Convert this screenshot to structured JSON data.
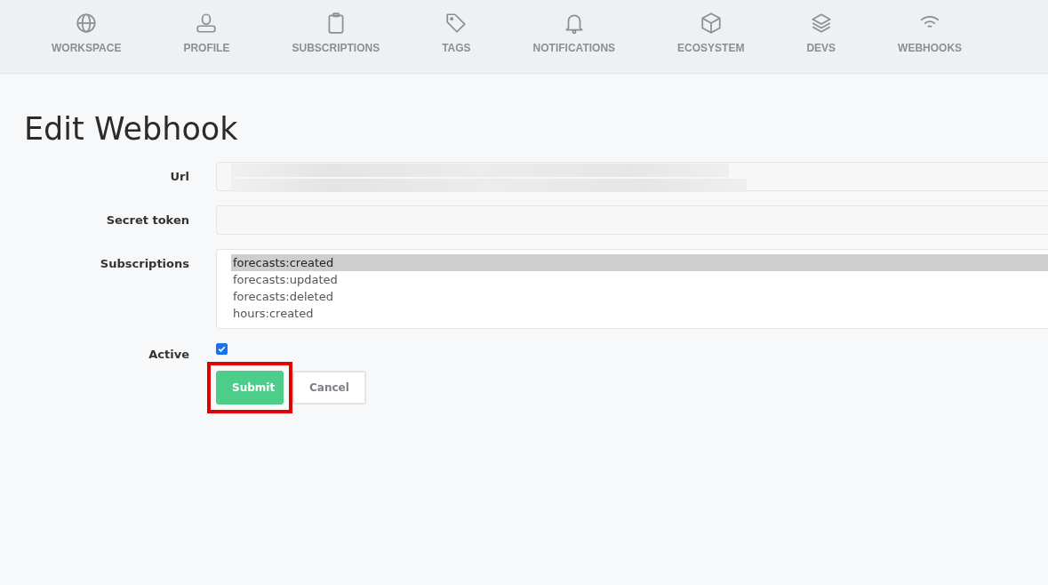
{
  "nav": [
    {
      "label": "WORKSPACE"
    },
    {
      "label": "PROFILE"
    },
    {
      "label": "SUBSCRIPTIONS"
    },
    {
      "label": "TAGS"
    },
    {
      "label": "NOTIFICATIONS"
    },
    {
      "label": "ECOSYSTEM"
    },
    {
      "label": "DEVS"
    },
    {
      "label": "WEBHOOKS"
    }
  ],
  "title": "Edit Webhook",
  "form": {
    "url": {
      "label": "Url",
      "redacted": true
    },
    "secret": {
      "label": "Secret token"
    },
    "subscriptions": {
      "label": "Subscriptions",
      "options": [
        {
          "label": "forecasts:created",
          "selected": true
        },
        {
          "label": "forecasts:updated",
          "selected": false
        },
        {
          "label": "forecasts:deleted",
          "selected": false
        },
        {
          "label": "hours:created",
          "selected": false
        }
      ]
    },
    "active": {
      "label": "Active",
      "checked": true
    }
  },
  "buttons": [
    {
      "label": "Submit",
      "kind": "primary",
      "highlighted": true
    },
    {
      "label": "Cancel",
      "kind": "secondary",
      "highlighted": false
    }
  ]
}
